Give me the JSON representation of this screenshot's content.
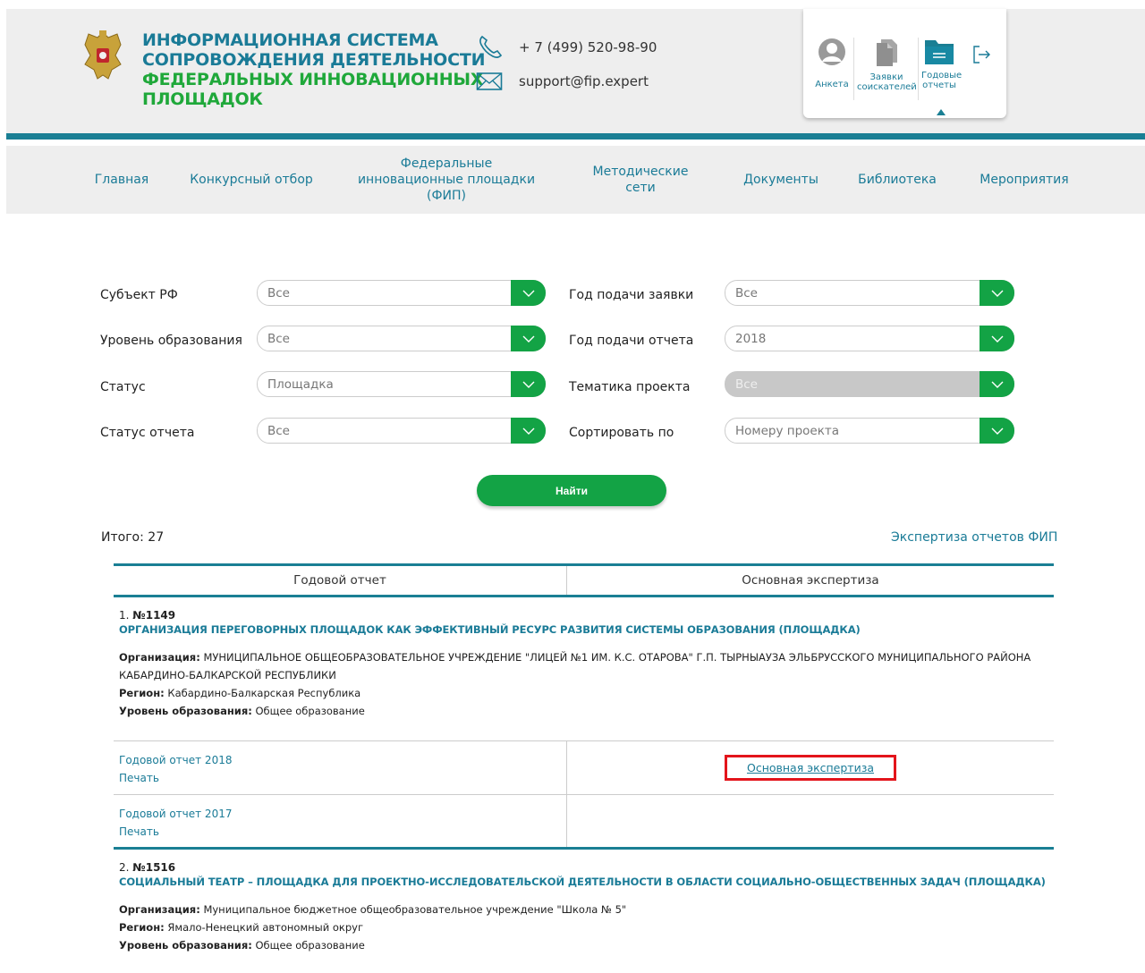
{
  "header": {
    "title_line1": "ИНФОРМАЦИОННАЯ СИСТЕМА",
    "title_line2": "СОПРОВОЖДЕНИЯ ДЕЯТЕЛЬНОСТИ",
    "title_line3": "ФЕДЕРАЛЬНЫХ ИННОВАЦИОННЫХ",
    "title_line4": "ПЛОЩАДОК",
    "phone": "+ 7 (499) 520-98-90",
    "email": "support@fip.expert"
  },
  "user_panel": {
    "profile_label": "Анкета",
    "applications_label_1": "Заявки",
    "applications_label_2": "соискателей",
    "reports_label_1": "Годовые",
    "reports_label_2": "отчеты"
  },
  "nav": {
    "items": [
      {
        "label": "Главная"
      },
      {
        "label": "Конкурсный отбор"
      },
      {
        "label": "Федеральные инновационные площадки (ФИП)"
      },
      {
        "label": "Методические сети"
      },
      {
        "label": "Документы"
      },
      {
        "label": "Библиотека"
      },
      {
        "label": "Мероприятия"
      }
    ]
  },
  "filters": {
    "subject_label": "Субъект РФ",
    "subject_value": "Все",
    "level_label": "Уровень образования",
    "level_value": "Все",
    "status_label": "Статус",
    "status_value": "Площадка",
    "report_status_label": "Статус отчета",
    "report_status_value": "Все",
    "app_year_label": "Год подачи заявки",
    "app_year_value": "Все",
    "report_year_label": "Год подачи отчета",
    "report_year_value": "2018",
    "topic_label": "Тематика проекта",
    "topic_value": "Все",
    "sort_label": "Сортировать по",
    "sort_value": "Номеру проекта",
    "search_button": "Найти"
  },
  "summary": {
    "total": "Итого: 27",
    "expertise_link": "Экспертиза отчетов ФИП"
  },
  "table": {
    "col1": "Годовой отчет",
    "col2": "Основная экспертиза"
  },
  "records": [
    {
      "index": "1.",
      "number": "№1149",
      "title": "ОРГАНИЗАЦИЯ ПЕРЕГОВОРНЫХ ПЛОЩАДОК КАК ЭФФЕКТИВНЫЙ РЕСУРС РАЗВИТИЯ СИСТЕМЫ ОБРАЗОВАНИЯ (ПЛОЩАДКА)",
      "org_label": "Организация:",
      "org": "МУНИЦИПАЛЬНОЕ ОБЩЕОБРАЗОВАТЕЛЬНОЕ УЧРЕЖДЕНИЕ \"ЛИЦЕЙ №1 ИМ. К.С. ОТАРОВА\" Г.П. ТЫРНЫАУЗА ЭЛЬБРУССКОГО МУНИЦИПАЛЬНОГО РАЙОНА КАБАРДИНО-БАЛКАРСКОЙ РЕСПУБЛИКИ",
      "region_label": "Регион:",
      "region": "Кабардино-Балкарская Республика",
      "level_label": "Уровень образования:",
      "level": "Общее образование",
      "reports": [
        {
          "report": "Годовой отчет 2018",
          "print": "Печать",
          "expertise": "Основная экспертиза"
        },
        {
          "report": "Годовой отчет 2017",
          "print": "Печать",
          "expertise": ""
        }
      ]
    },
    {
      "index": "2.",
      "number": "№1516",
      "title": "СОЦИАЛЬНЫЙ ТЕАТР – ПЛОЩАДКА ДЛЯ ПРОЕКТНО-ИССЛЕДОВАТЕЛЬСКОЙ ДЕЯТЕЛЬНОСТИ В ОБЛАСТИ СОЦИАЛЬНО-ОБЩЕСТВЕННЫХ ЗАДАЧ (ПЛОЩАДКА)",
      "org_label": "Организация:",
      "org": "Муниципальное бюджетное общеобразовательное учреждение \"Школа № 5\"",
      "region_label": "Регион:",
      "region": "Ямало-Ненецкий автономный округ",
      "level_label": "Уровень образования:",
      "level": "Общее образование"
    }
  ],
  "colors": {
    "brand_blue": "#1a7b97",
    "brand_green": "#13a345",
    "highlight_red": "#e3141b"
  }
}
